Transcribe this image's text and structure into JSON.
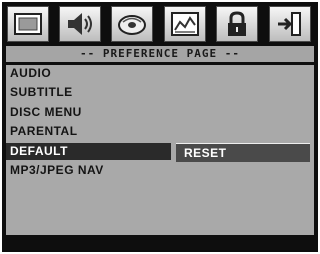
{
  "tabs": [
    {
      "icon": "general-setup-icon"
    },
    {
      "icon": "speaker-setup-icon"
    },
    {
      "icon": "disc-setup-icon"
    },
    {
      "icon": "preference-icon"
    },
    {
      "icon": "lock-icon"
    },
    {
      "icon": "exit-icon"
    }
  ],
  "page_title": "-- PREFERENCE PAGE --",
  "menu_items": [
    "AUDIO",
    "SUBTITLE",
    "DISC MENU",
    "PARENTAL",
    "DEFAULT",
    "MP3/JPEG NAV"
  ],
  "selected_item": "DEFAULT",
  "submenu": {
    "option": "RESET"
  }
}
